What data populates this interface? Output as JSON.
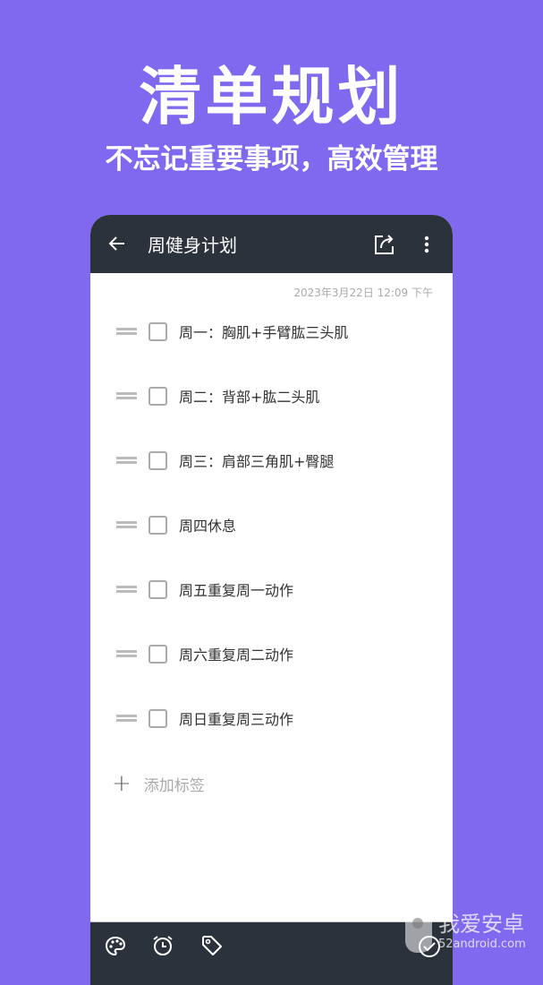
{
  "hero": {
    "title": "清单规划",
    "subtitle": "不忘记重要事项，高效管理"
  },
  "toolbar": {
    "title": "周健身计划",
    "back_icon": "arrow-left-icon",
    "share_icon": "share-icon",
    "more_icon": "more-vertical-icon"
  },
  "note": {
    "date": "2023年3月22日 12:09 下午",
    "items": [
      {
        "text": "周一：胸肌+手臂肱三头肌",
        "checked": false
      },
      {
        "text": "周二：背部+肱二头肌",
        "checked": false
      },
      {
        "text": "周三：肩部三角肌+臀腿",
        "checked": false
      },
      {
        "text": "周四休息",
        "checked": false
      },
      {
        "text": "周五重复周一动作",
        "checked": false
      },
      {
        "text": "周六重复周二动作",
        "checked": false
      },
      {
        "text": "周日重复周三动作",
        "checked": false
      }
    ],
    "add_tag": "添加标签"
  },
  "bottom_bar": {
    "icons": [
      "palette-icon",
      "alarm-icon",
      "tag-icon",
      "check-circle-icon"
    ]
  },
  "watermark": {
    "name": "我爱安卓",
    "url": "52android.com"
  },
  "colors": {
    "background": "#8068ef",
    "bar": "#2c323c"
  }
}
